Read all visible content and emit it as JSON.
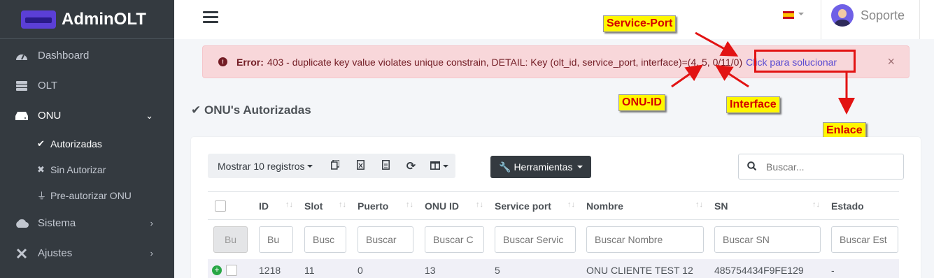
{
  "brand": {
    "name": "AdminOLT"
  },
  "sidebar": {
    "items": [
      {
        "label": "Dashboard",
        "icon": "tachometer-icon"
      },
      {
        "label": "OLT",
        "icon": "server-icon"
      },
      {
        "label": "ONU",
        "icon": "hdd-icon"
      },
      {
        "label": "Sistema",
        "icon": "cloud-icon"
      },
      {
        "label": "Ajustes",
        "icon": "tools-icon"
      }
    ],
    "onu_sub": [
      {
        "label": "Autorizadas",
        "icon": "check-icon"
      },
      {
        "label": "Sin Autorizar",
        "icon": "times-icon"
      },
      {
        "label": "Pre-autorizar ONU",
        "icon": "plug-icon"
      }
    ]
  },
  "topbar": {
    "user_name": "Soporte",
    "language_flag": "es"
  },
  "alert": {
    "label": "Error:",
    "message": "403 - duplicate key value violates unique constrain, DETAIL: Key (olt_id, service_port, interface)=(4, 5, 0/11/0)",
    "link": "Click para solucionar",
    "close": "×"
  },
  "annotations": {
    "service_port": "Service-Port",
    "onu_id": "ONU-ID",
    "interface": "Interface",
    "enlace": "Enlace"
  },
  "page": {
    "title": "ONU's Autorizadas"
  },
  "toolbar": {
    "show_records": "Mostrar 10 registros",
    "tools": "Herramientas"
  },
  "search": {
    "placeholder": "Buscar..."
  },
  "table": {
    "headers": [
      "ID",
      "Slot",
      "Puerto",
      "ONU ID",
      "Service port",
      "Nombre",
      "SN",
      "Estado"
    ],
    "filters": {
      "bu": "Bu",
      "id": "Bu",
      "slot": "Busc",
      "puerto": "Buscar",
      "onu_id": "Buscar C",
      "service_port": "Buscar Servic",
      "nombre": "Buscar Nombre",
      "sn": "Buscar SN",
      "estado": "Buscar Est"
    },
    "rows": [
      {
        "id": "1218",
        "slot": "11",
        "puerto": "0",
        "onu_id": "13",
        "service_port": "5",
        "nombre": "ONU CLIENTE TEST 12",
        "sn": "485754434F9FE129",
        "estado": "-"
      }
    ]
  },
  "colors": {
    "sidebar": "#343a40",
    "alert_bg": "#f8d7da",
    "callout_bg": "#fff700",
    "callout_text": "#d40000",
    "arrow": "#e21313"
  }
}
